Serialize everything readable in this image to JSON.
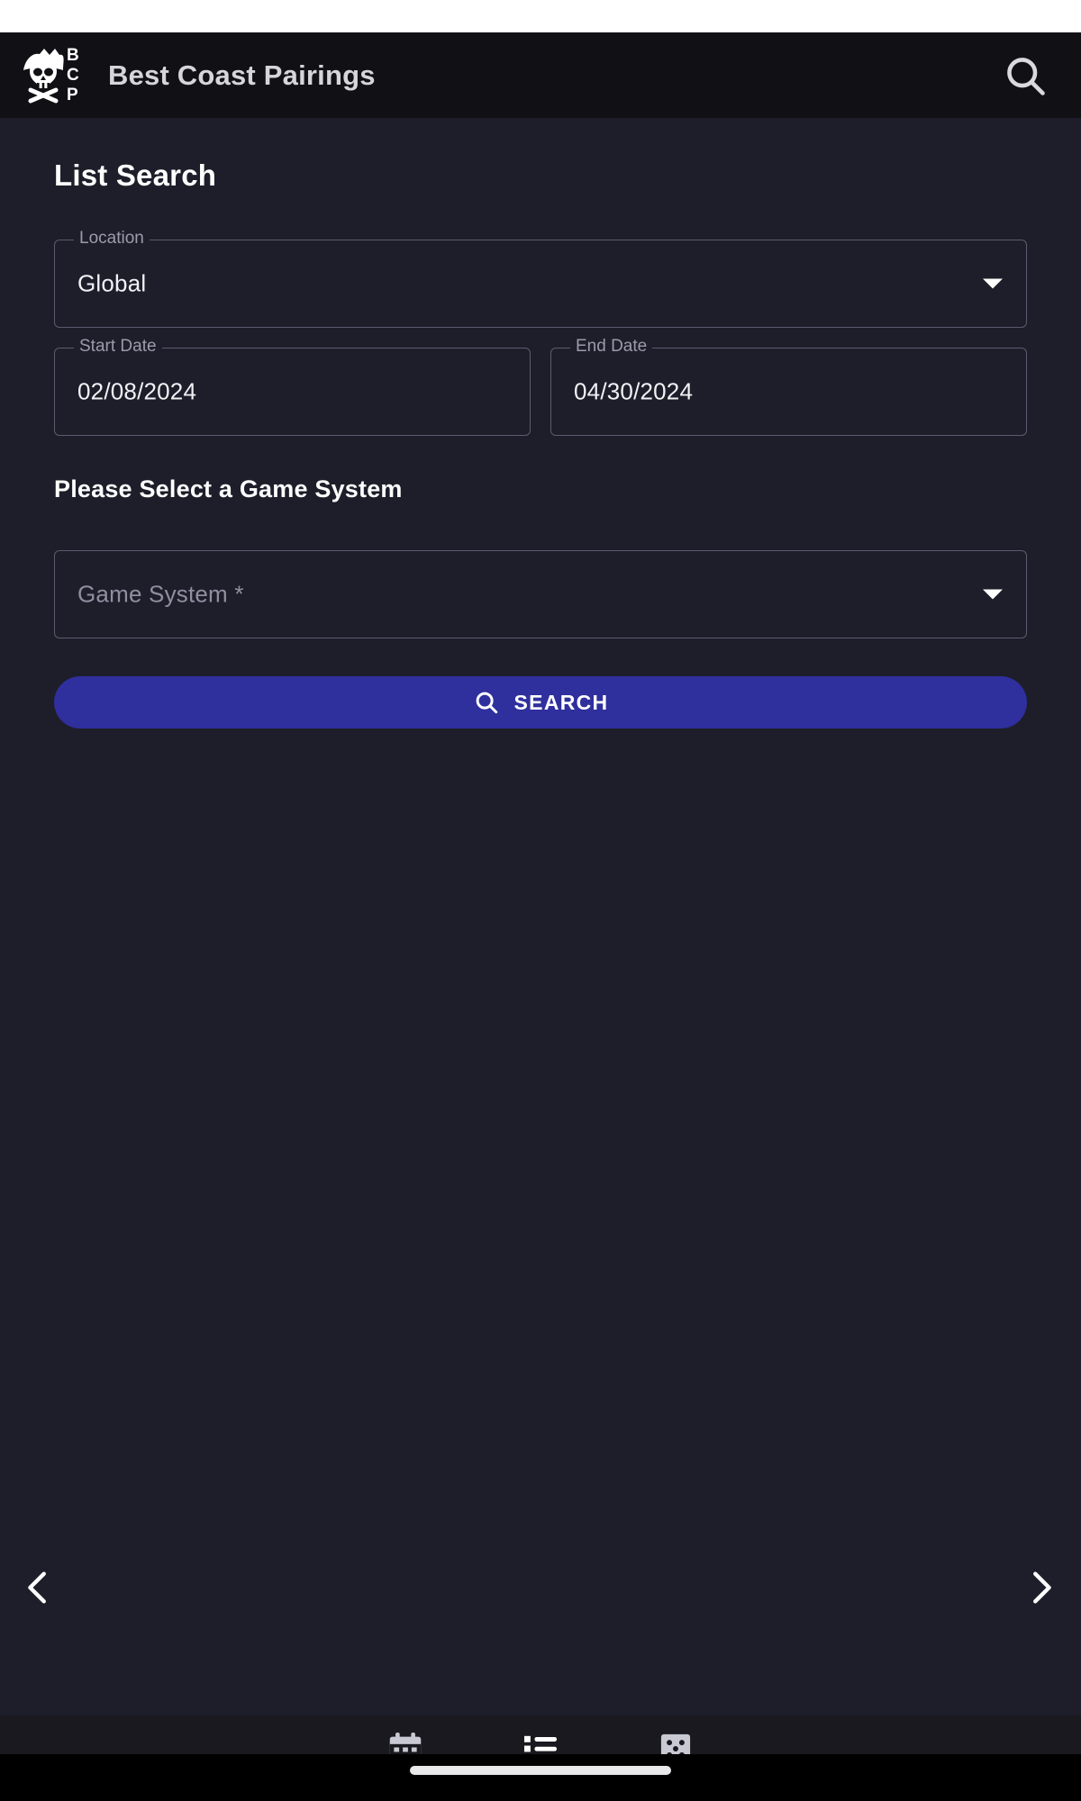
{
  "app": {
    "title": "Best Coast Pairings",
    "logo_icon": "bcp-pirate-skull-logo",
    "logo_letters": [
      "B",
      "C",
      "P"
    ],
    "search_icon": "search-icon"
  },
  "page": {
    "title": "List Search"
  },
  "form": {
    "location": {
      "label": "Location",
      "value": "Global",
      "dropdown_icon": "caret-down-icon"
    },
    "start_date": {
      "label": "Start Date",
      "value": "02/08/2024"
    },
    "end_date": {
      "label": "End Date",
      "value": "04/30/2024"
    },
    "game_system_heading": "Please Select a Game System",
    "game_system": {
      "placeholder": "Game System *",
      "value": "",
      "dropdown_icon": "caret-down-icon"
    },
    "search_button": {
      "label": "SEARCH",
      "icon": "search-icon",
      "color": "#2f2f9e"
    }
  },
  "carousel": {
    "prev_icon": "chevron-left-icon",
    "next_icon": "chevron-right-icon"
  },
  "bottom_nav": {
    "items": [
      {
        "name": "events",
        "icon": "calendar-icon",
        "active": false
      },
      {
        "name": "lists",
        "icon": "list-icon",
        "active": true
      },
      {
        "name": "dice",
        "icon": "dice-icon",
        "active": false
      }
    ]
  },
  "colors": {
    "background": "#1d1e2a",
    "app_bar": "#111115",
    "accent": "#2f2f9e",
    "bottom_nav": "#19191f",
    "field_border": "#5a5c6e",
    "label_text": "#9a9cab"
  }
}
